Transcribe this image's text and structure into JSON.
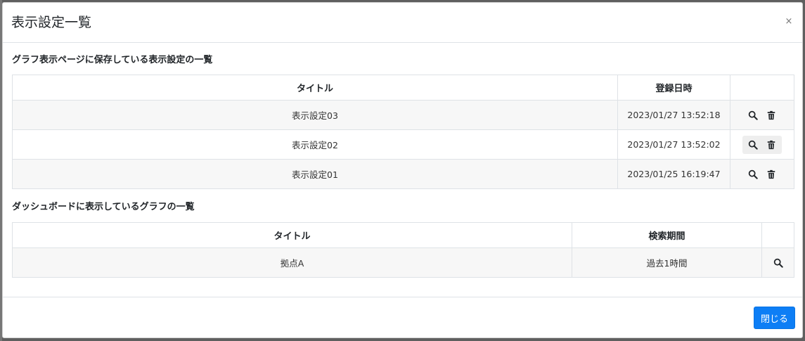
{
  "modal": {
    "title": "表示設定一覧",
    "close_glyph": "×"
  },
  "saved_settings": {
    "section_title": "グラフ表示ページに保存している表示設定の一覧",
    "columns": [
      "タイトル",
      "登録日時",
      ""
    ],
    "rows": [
      {
        "title": "表示設定03",
        "registered_at": "2023/01/27 13:52:18"
      },
      {
        "title": "表示設定02",
        "registered_at": "2023/01/27 13:52:02"
      },
      {
        "title": "表示設定01",
        "registered_at": "2023/01/25 16:19:47"
      }
    ],
    "icons": [
      "search-icon",
      "trash-icon"
    ]
  },
  "dashboard_graphs": {
    "section_title": "ダッシュボードに表示しているグラフの一覧",
    "columns": [
      "タイトル",
      "検索期間",
      ""
    ],
    "rows": [
      {
        "title": "拠点A",
        "period": "過去1時間"
      }
    ],
    "icons": [
      "search-icon"
    ]
  },
  "footer": {
    "close_label": "閉じる"
  },
  "colors": {
    "primary_button": "#0d7ef5",
    "stripe_row": "#f7f7f7",
    "border": "#dee2e6"
  }
}
